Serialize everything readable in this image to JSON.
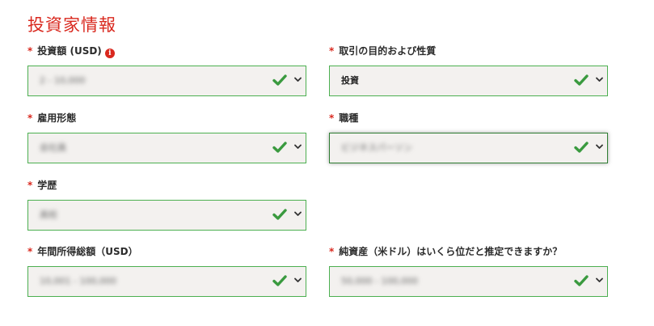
{
  "section_title": "投資家情報",
  "required_mark": "*",
  "info_icon_glyph": "i",
  "fields": {
    "investment_amount": {
      "label": "投資額 (USD)",
      "value": "2 - 10,000",
      "obscured": true
    },
    "purpose": {
      "label": "取引の目的および性質",
      "value": "投資",
      "obscured": false
    },
    "employment": {
      "label": "雇用形態",
      "value": "会社員",
      "obscured": true
    },
    "occupation": {
      "label": "職種",
      "value": "ビジネスパーソン",
      "obscured": true
    },
    "education": {
      "label": "学歴",
      "value": "高校",
      "obscured": true
    },
    "annual_income": {
      "label": "年間所得総額（USD）",
      "value": "10,001 - 100,000",
      "obscured": true
    },
    "net_worth": {
      "label": "純資産（米ドル）はいくら位だと推定できますか？",
      "value": "50,000 - 100,000",
      "obscured": true
    }
  },
  "colors": {
    "accent_red": "#d9281e",
    "check_green": "#3a9a3f",
    "field_border": "#4caf50",
    "field_bg": "#f3f1ef"
  },
  "icons": {
    "valid": "check-icon",
    "dropdown": "chevron-down-icon",
    "info": "info-icon"
  }
}
